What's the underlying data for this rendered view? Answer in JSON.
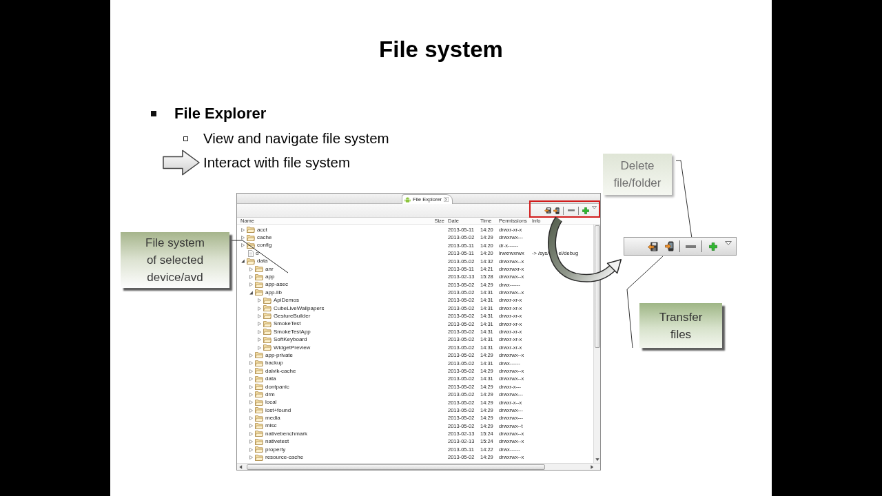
{
  "slide": {
    "title": "File system"
  },
  "bullets": [
    {
      "kind": "square",
      "text": "File Explorer",
      "children": [
        {
          "kind": "hollow",
          "text": "View and navigate file system"
        },
        {
          "kind": "arrow",
          "text": "Interact with file system"
        }
      ]
    }
  ],
  "file_explorer": {
    "tab": "File Explorer",
    "columns": [
      "Name",
      "Size",
      "Date",
      "Time",
      "Permissions",
      "Info"
    ],
    "rows": [
      {
        "name": "acct",
        "kind": "folder",
        "expanded": false,
        "date": "2013-05-11",
        "time": "14:20",
        "permissions": "drwxr-xr-x"
      },
      {
        "name": "cache",
        "kind": "folder",
        "expanded": false,
        "date": "2013-05-02",
        "time": "14:29",
        "permissions": "drwxrwx---"
      },
      {
        "name": "config",
        "kind": "folder",
        "expanded": false,
        "date": "2013-05-11",
        "time": "14:20",
        "permissions": "dr-x------"
      },
      {
        "name": "d",
        "kind": "file",
        "date": "2013-05-11",
        "time": "14:20",
        "permissions": "lrwxrwxrwx",
        "info": [
          "-> /sys/",
          "el/debug"
        ]
      },
      {
        "name": "data",
        "kind": "folder",
        "expanded": true,
        "date": "2013-05-02",
        "time": "14:32",
        "permissions": "drwxrwx--x",
        "children": [
          {
            "name": "anr",
            "kind": "folder",
            "expanded": false,
            "date": "2013-05-11",
            "time": "14:21",
            "permissions": "drwxrwxr-x"
          },
          {
            "name": "app",
            "kind": "folder",
            "expanded": false,
            "date": "2013-02-13",
            "time": "15:28",
            "permissions": "drwxrwx--x"
          },
          {
            "name": "app-asec",
            "kind": "folder",
            "expanded": false,
            "date": "2013-05-02",
            "time": "14:29",
            "permissions": "drwx------"
          },
          {
            "name": "app-lib",
            "kind": "folder",
            "expanded": true,
            "date": "2013-05-02",
            "time": "14:31",
            "permissions": "drwxrwx--x",
            "children": [
              {
                "name": "ApiDemos",
                "kind": "folder",
                "expanded": false,
                "date": "2013-05-02",
                "time": "14:31",
                "permissions": "drwxr-xr-x"
              },
              {
                "name": "CubeLiveWallpapers",
                "kind": "folder",
                "expanded": false,
                "date": "2013-05-02",
                "time": "14:31",
                "permissions": "drwxr-xr-x"
              },
              {
                "name": "GestureBuilder",
                "kind": "folder",
                "expanded": false,
                "date": "2013-05-02",
                "time": "14:31",
                "permissions": "drwxr-xr-x"
              },
              {
                "name": "SmokeTest",
                "kind": "folder",
                "expanded": false,
                "date": "2013-05-02",
                "time": "14:31",
                "permissions": "drwxr-xr-x"
              },
              {
                "name": "SmokeTestApp",
                "kind": "folder",
                "expanded": false,
                "date": "2013-05-02",
                "time": "14:31",
                "permissions": "drwxr-xr-x"
              },
              {
                "name": "SoftKeyboard",
                "kind": "folder",
                "expanded": false,
                "date": "2013-05-02",
                "time": "14:31",
                "permissions": "drwxr-xr-x"
              },
              {
                "name": "WidgetPreview",
                "kind": "folder",
                "expanded": false,
                "date": "2013-05-02",
                "time": "14:31",
                "permissions": "drwxr-xr-x"
              }
            ]
          },
          {
            "name": "app-private",
            "kind": "folder",
            "expanded": false,
            "date": "2013-05-02",
            "time": "14:29",
            "permissions": "drwxrwx--x"
          },
          {
            "name": "backup",
            "kind": "folder",
            "expanded": false,
            "date": "2013-05-02",
            "time": "14:31",
            "permissions": "drwx------"
          },
          {
            "name": "dalvik-cache",
            "kind": "folder",
            "expanded": false,
            "date": "2013-05-02",
            "time": "14:29",
            "permissions": "drwxrwx--x"
          },
          {
            "name": "data",
            "kind": "folder",
            "expanded": false,
            "date": "2013-05-02",
            "time": "14:31",
            "permissions": "drwxrwx--x"
          },
          {
            "name": "dontpanic",
            "kind": "folder",
            "expanded": false,
            "date": "2013-05-02",
            "time": "14:29",
            "permissions": "drwxr-x---"
          },
          {
            "name": "drm",
            "kind": "folder",
            "expanded": false,
            "date": "2013-05-02",
            "time": "14:29",
            "permissions": "drwxrwx---"
          },
          {
            "name": "local",
            "kind": "folder",
            "expanded": false,
            "date": "2013-05-02",
            "time": "14:29",
            "permissions": "drwxr-x--x"
          },
          {
            "name": "lost+found",
            "kind": "folder",
            "expanded": false,
            "date": "2013-05-02",
            "time": "14:29",
            "permissions": "drwxrwx---"
          },
          {
            "name": "media",
            "kind": "folder",
            "expanded": false,
            "date": "2013-05-02",
            "time": "14:29",
            "permissions": "drwxrwx---"
          },
          {
            "name": "misc",
            "kind": "folder",
            "expanded": false,
            "date": "2013-05-02",
            "time": "14:29",
            "permissions": "drwxrwx--t"
          },
          {
            "name": "nativebenchmark",
            "kind": "folder",
            "expanded": false,
            "date": "2013-02-13",
            "time": "15:24",
            "permissions": "drwxrwx--x"
          },
          {
            "name": "nativetest",
            "kind": "folder",
            "expanded": false,
            "date": "2013-02-13",
            "time": "15:24",
            "permissions": "drwxrwx--x"
          },
          {
            "name": "property",
            "kind": "folder",
            "expanded": false,
            "date": "2013-05-11",
            "time": "14:22",
            "permissions": "drwx------"
          },
          {
            "name": "resource-cache",
            "kind": "folder",
            "expanded": false,
            "date": "2013-05-02",
            "time": "14:29",
            "permissions": "drwxrwx--x"
          }
        ]
      }
    ]
  },
  "callouts": [
    {
      "text": "File system\nof selected\ndevice/avd"
    },
    {
      "text": "Delete\nfile/folder"
    },
    {
      "text": "Transfer\nfiles"
    }
  ]
}
